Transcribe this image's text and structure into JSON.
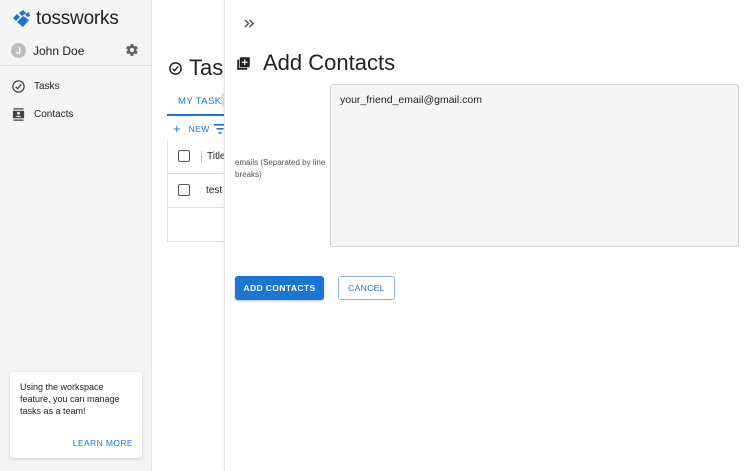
{
  "brand": {
    "name": "tossworks",
    "color": "#1976d2"
  },
  "user": {
    "initial": "J",
    "name": "John Doe"
  },
  "nav": [
    {
      "label": "Tasks",
      "icon": "check-circle-icon"
    },
    {
      "label": "Contacts",
      "icon": "contacts-icon"
    }
  ],
  "promo": {
    "text": "Using the workspace feature, you can manage tasks as a team!",
    "link": "LEARN MORE"
  },
  "tasks": {
    "title": "Tas",
    "tab": "MY TASK",
    "new_label": "NEW",
    "column_title": "Title",
    "rows": [
      {
        "title": "test"
      }
    ]
  },
  "drawer": {
    "title": "Add Contacts",
    "field_label": "emails (Separated by line breaks)",
    "email_value": "your_friend_email@gmail.com",
    "submit_label": "ADD CONTACTS",
    "cancel_label": "CANCEL"
  },
  "colors": {
    "accent": "#1976d2",
    "sidebar_bg": "#f5f5f5"
  }
}
